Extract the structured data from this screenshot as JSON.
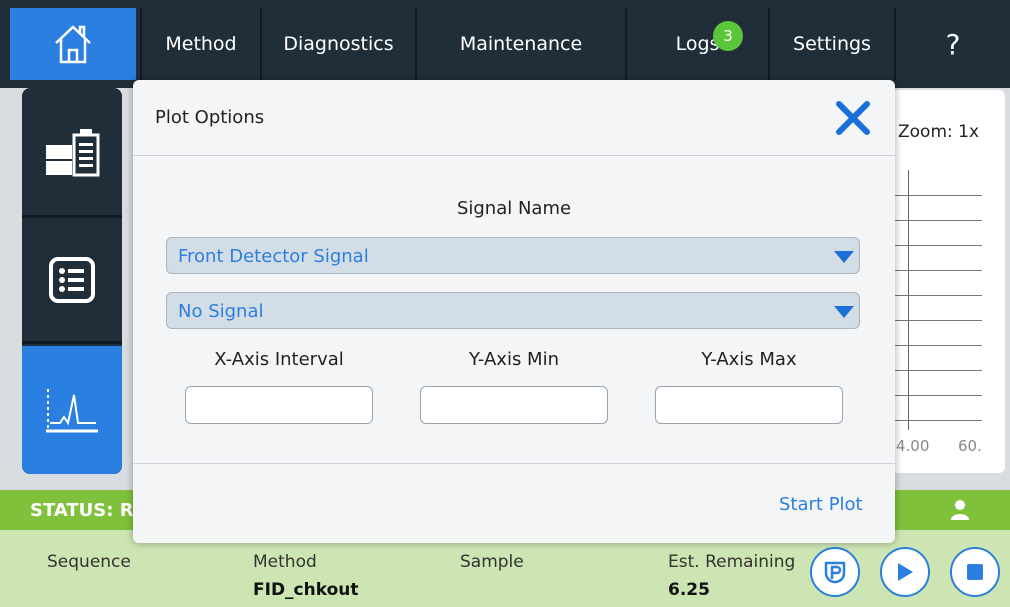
{
  "nav": {
    "items": [
      "Method",
      "Diagnostics",
      "Maintenance",
      "Logs",
      "Settings",
      "?"
    ],
    "logs_badge": "3"
  },
  "plot_panel": {
    "zoom": "Zoom: 1x",
    "ticks": [
      "4.00",
      "60."
    ]
  },
  "status": {
    "text": "STATUS: R"
  },
  "info": {
    "sequence_label": "Sequence",
    "method_label": "Method",
    "method_value": "FID_chkout",
    "sample_label": "Sample",
    "remaining_label": "Est. Remaining",
    "remaining_value": "6.25"
  },
  "modal": {
    "title": "Plot Options",
    "signal_name_label": "Signal Name",
    "signal_1": "Front Detector Signal",
    "signal_2": "No Signal",
    "x_interval_label": "X-Axis Interval",
    "y_min_label": "Y-Axis Min",
    "y_max_label": "Y-Axis Max",
    "x_interval_value": "",
    "y_min_value": "",
    "y_max_value": "",
    "start_plot": "Start Plot"
  },
  "colors": {
    "accent": "#2b7fe0",
    "nav_bg": "#1f2e39",
    "status_green": "#7fc13a",
    "info_green": "#cde5b3",
    "badge_green": "#5cc63a"
  },
  "icons": [
    "home-icon",
    "instrument-icon",
    "list-icon",
    "chromatogram-icon",
    "close-icon",
    "chevron-down-icon",
    "person-icon",
    "prep-run-icon",
    "play-icon",
    "stop-icon"
  ]
}
